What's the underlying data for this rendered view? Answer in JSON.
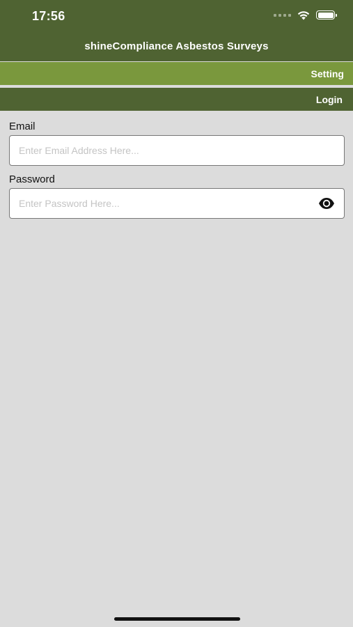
{
  "status_bar": {
    "time": "17:56",
    "signal_icon": "signal-dots-icon",
    "wifi_icon": "wifi-icon",
    "battery_icon": "battery-icon",
    "battery_level": 1.0
  },
  "header": {
    "title": "shineCompliance Asbestos Surveys"
  },
  "nav": {
    "setting_label": "Setting",
    "login_label": "Login"
  },
  "form": {
    "email": {
      "label": "Email",
      "value": "",
      "placeholder": "Enter Email Address Here..."
    },
    "password": {
      "label": "Password",
      "value": "",
      "placeholder": "Enter Password Here...",
      "toggle_icon": "eye-icon"
    }
  },
  "colors": {
    "header_bg": "#4f6332",
    "setting_bar_bg": "#7a983d",
    "login_bar_bg": "#4f6332",
    "page_bg": "#dcdcdc"
  }
}
